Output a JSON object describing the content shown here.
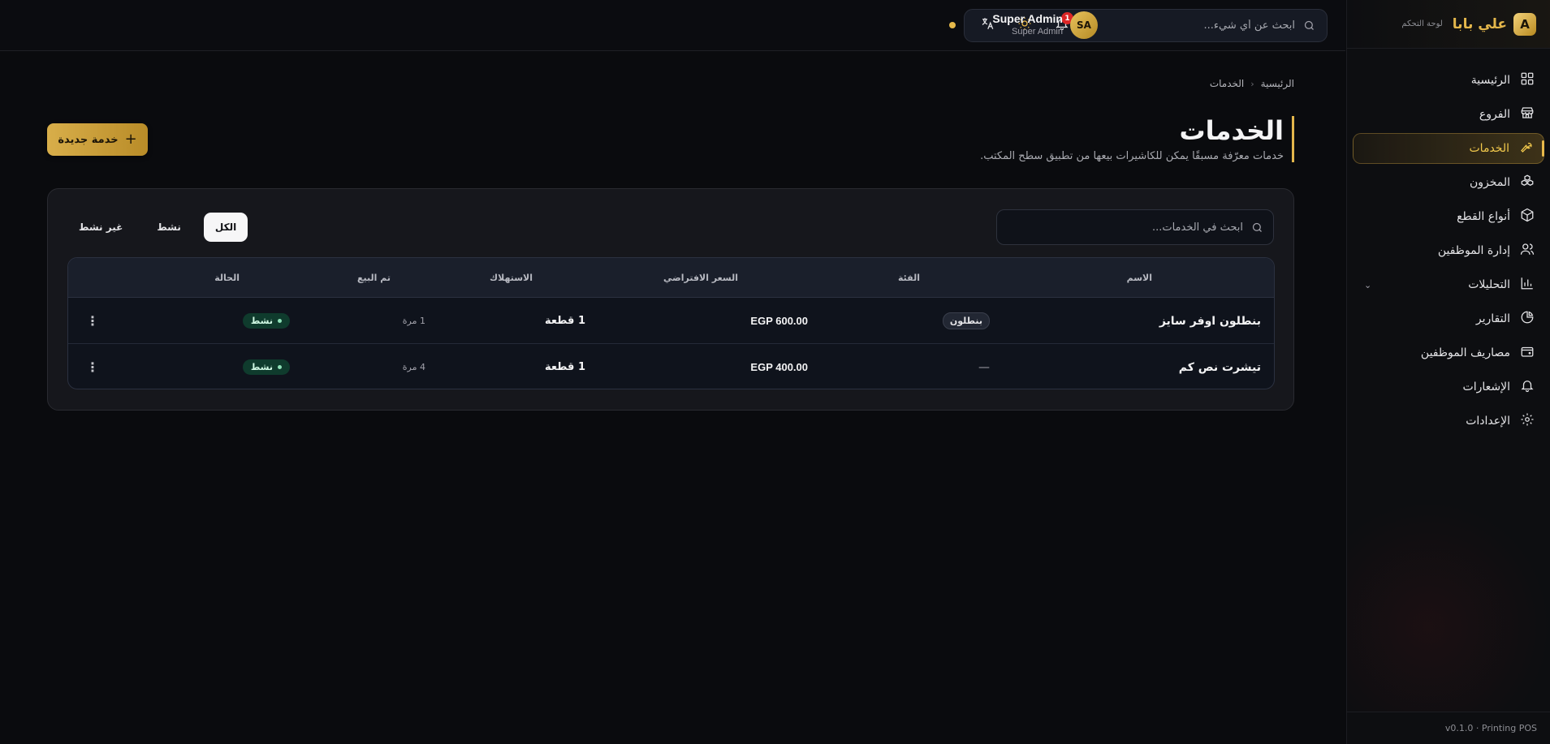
{
  "brand": {
    "logo_letter": "A",
    "name": "علي بابا",
    "subtitle": "لوحة التحكم"
  },
  "sidebar": {
    "items": [
      {
        "label": "الرئيسية",
        "icon": "dashboard-icon"
      },
      {
        "label": "الفروع",
        "icon": "store-icon"
      },
      {
        "label": "الخدمات",
        "icon": "wrench-icon",
        "active": true
      },
      {
        "label": "المخزون",
        "icon": "boxes-icon"
      },
      {
        "label": "أنواع القطع",
        "icon": "box-icon"
      },
      {
        "label": "إدارة الموظفين",
        "icon": "users-icon"
      },
      {
        "label": "التحليلات",
        "icon": "chart-icon",
        "expandable": true
      },
      {
        "label": "التقارير",
        "icon": "pie-chart-icon"
      },
      {
        "label": "مصاريف الموظفين",
        "icon": "wallet-icon"
      },
      {
        "label": "الإشعارات",
        "icon": "bell-icon"
      },
      {
        "label": "الإعدادات",
        "icon": "gear-icon"
      }
    ],
    "version": "v0.1.0 · Printing POS"
  },
  "topbar": {
    "search_placeholder": "ابحث عن أي شيء...",
    "notification_count": "1",
    "avatar_initials": "SA",
    "user_name": "Super Admin",
    "user_role": "Super Admin"
  },
  "breadcrumb": {
    "home": "الرئيسية",
    "current": "الخدمات"
  },
  "page": {
    "title": "الخدمات",
    "subtitle": "خدمات معرّفة مسبقًا يمكن للكاشيرات بيعها من تطبيق سطح المكتب.",
    "new_button": "خدمة جديدة"
  },
  "table": {
    "search_placeholder": "ابحث في الخدمات...",
    "filters": [
      "الكل",
      "نشط",
      "غير نشط"
    ],
    "columns": {
      "name": "الاسم",
      "category": "الفئة",
      "price": "السعر الافتراضي",
      "consumption": "الاستهلاك",
      "sold": "تم البيع",
      "status": "الحالة"
    },
    "rows": [
      {
        "name": "بنطلون اوفر سايز",
        "category": "بنطلون",
        "price": "EGP 600.00",
        "consumption": "1 قطعة",
        "sold": "1 مرة",
        "status": "نشط"
      },
      {
        "name": "تيشرت نص كم",
        "category": "—",
        "price": "EGP 400.00",
        "consumption": "1 قطعة",
        "sold": "4 مرة",
        "status": "نشط"
      }
    ]
  },
  "colors": {
    "accent": "#e3b64b",
    "background": "#0a0b0e",
    "status_active": "#0f3b2d",
    "notification": "#dc2626"
  }
}
